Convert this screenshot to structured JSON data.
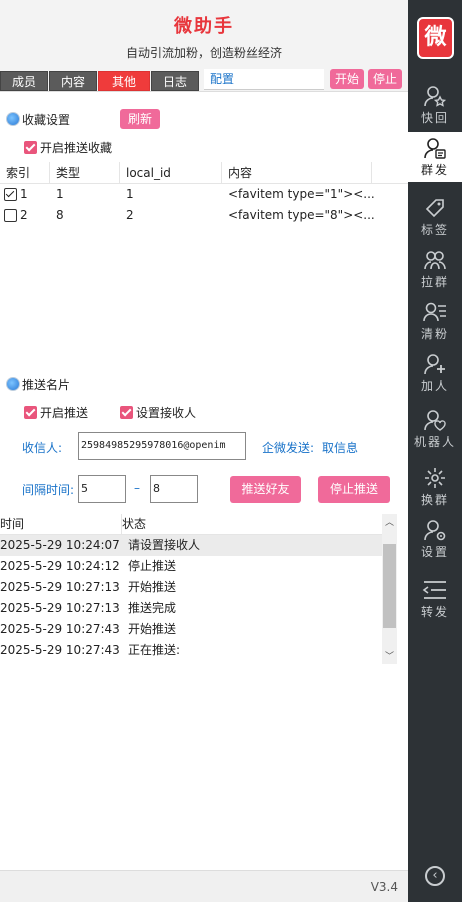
{
  "header": {
    "title": "微助手",
    "subtitle": "自动引流加粉，创造粉丝经济"
  },
  "tabs": [
    {
      "label": "成员",
      "active": false
    },
    {
      "label": "内容",
      "active": false
    },
    {
      "label": "其他",
      "active": true
    },
    {
      "label": "日志",
      "active": false
    }
  ],
  "config_link": "配置",
  "toolbar": {
    "start": "开始",
    "stop": "停止"
  },
  "favorites": {
    "title": "收藏设置",
    "refresh": "刷新",
    "enable_label": "开启推送收藏",
    "enable_checked": true,
    "columns": [
      "索引",
      "类型",
      "local_id",
      "内容"
    ],
    "rows": [
      {
        "checked": true,
        "index": "1",
        "type": "1",
        "local_id": "1",
        "content": "<favitem type=\"1\"><..."
      },
      {
        "checked": false,
        "index": "2",
        "type": "8",
        "local_id": "2",
        "content": "<favitem type=\"8\"><..."
      }
    ]
  },
  "card_push": {
    "title": "推送名片",
    "enable_label": "开启推送",
    "enable_checked": true,
    "set_receiver_label": "设置接收人",
    "set_receiver_checked": true,
    "receiver_label": "收信人:",
    "receiver_value": "25984985295978016@openim",
    "wecom_send_label": "企微发送:",
    "fetch_info_link": "取信息",
    "interval_label": "间隔时间:",
    "interval_min": "5",
    "interval_sep": "–",
    "interval_max": "8",
    "push_friends_button": "推送好友",
    "stop_push_button": "停止推送"
  },
  "log": {
    "columns": [
      "时间",
      "状态"
    ],
    "rows": [
      {
        "time": "2025-5-29 10:24:07",
        "status": "请设置接收人",
        "selected": true
      },
      {
        "time": "2025-5-29 10:24:12",
        "status": "停止推送",
        "selected": false
      },
      {
        "time": "2025-5-29 10:27:13",
        "status": "开始推送",
        "selected": false
      },
      {
        "time": "2025-5-29 10:27:13",
        "status": "推送完成",
        "selected": false
      },
      {
        "time": "2025-5-29 10:27:43",
        "status": "开始推送",
        "selected": false
      },
      {
        "time": "2025-5-29 10:27:43",
        "status": "正在推送:",
        "selected": false
      }
    ]
  },
  "status_bar": {
    "version": "V3.4"
  },
  "sidebar": {
    "logo_text": "微",
    "items": [
      {
        "label": "快回",
        "icon": "star-person-icon",
        "active": false
      },
      {
        "label": "群发",
        "icon": "broadcast-person-icon",
        "active": true
      },
      {
        "label": "标签",
        "icon": "tag-icon",
        "active": false
      },
      {
        "label": "拉群",
        "icon": "group-icon",
        "active": false
      },
      {
        "label": "清粉",
        "icon": "person-list-icon",
        "active": false
      },
      {
        "label": "加人",
        "icon": "add-person-icon",
        "active": false
      },
      {
        "label": "机器人",
        "icon": "robot-person-icon",
        "active": false
      },
      {
        "label": "换群",
        "icon": "switch-icon",
        "active": false
      },
      {
        "label": "设置",
        "icon": "settings-person-icon",
        "active": false
      },
      {
        "label": "转发",
        "icon": "forward-list-icon",
        "active": false
      }
    ]
  },
  "colors": {
    "brand_red": "#e8363c",
    "pink_button": "#f06a9a",
    "sidebar_bg": "#2d3236",
    "link_blue": "#1a73c9"
  }
}
